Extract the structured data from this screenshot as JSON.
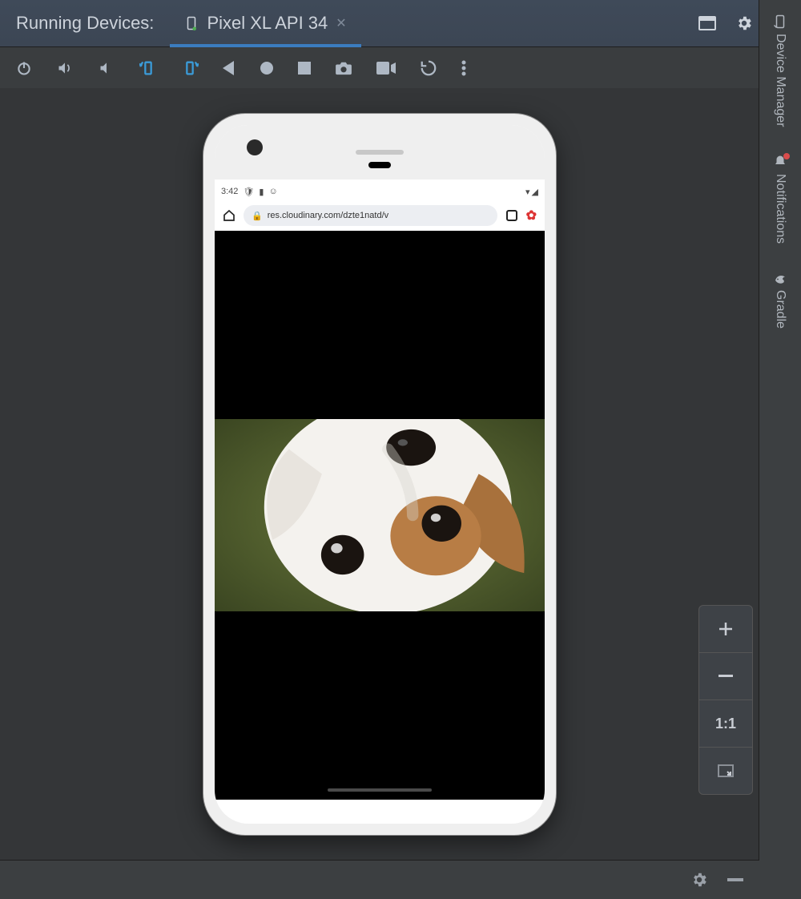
{
  "header": {
    "title": "Running Devices:",
    "tab_label": "Pixel XL API 34"
  },
  "device": {
    "statusbar_time": "3:42",
    "url_text": "res.cloudinary.com/dzte1natd/v"
  },
  "sidebar": {
    "device_manager": "Device Manager",
    "notifications": "Notifications",
    "gradle": "Gradle"
  },
  "zoom": {
    "one_to_one": "1:1"
  }
}
